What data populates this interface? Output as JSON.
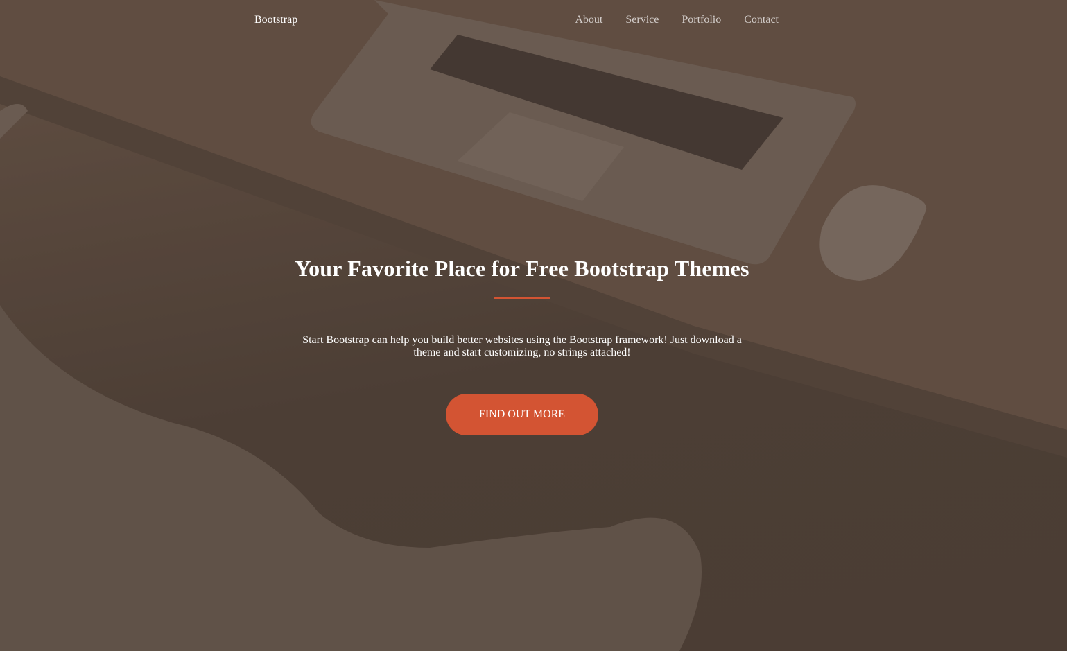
{
  "navbar": {
    "brand": "Bootstrap",
    "links": [
      {
        "label": "About"
      },
      {
        "label": "Service"
      },
      {
        "label": "Portfolio"
      },
      {
        "label": "Contact"
      }
    ]
  },
  "hero": {
    "headline": "Your Favorite Place for Free Bootstrap Themes",
    "lead": "Start Bootstrap can help you build better websites using the Bootstrap framework! Just download a theme and start customizing, no strings attached!",
    "cta_label": "FIND OUT MORE"
  },
  "colors": {
    "accent": "#d35433",
    "overlay": "#4d3f36",
    "text": "#ffffff"
  }
}
